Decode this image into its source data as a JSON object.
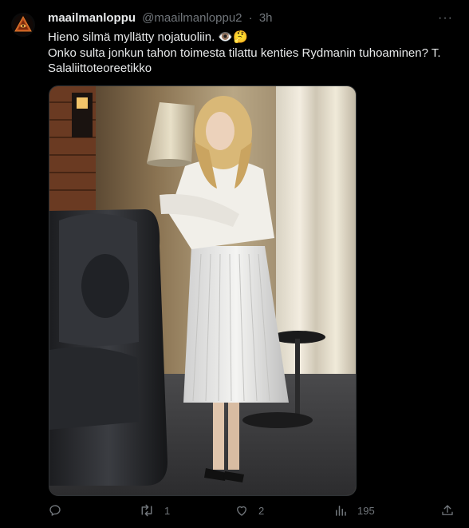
{
  "tweet": {
    "display_name": "maailmanloppu",
    "handle": "@maailmanloppu2",
    "separator": "·",
    "time": "3h",
    "more": "···",
    "text_line1": "Hieno silmä myllätty nojatuoliin. 👁️🤔",
    "text_line2": "Onko sulta jonkun tahon toimesta tilattu kenties Rydmanin tuhoaminen? T. Salaliittoteoreetikko"
  },
  "image": {
    "description_icon": "photo-woman-leaning-on-leather-armchair"
  },
  "actions": {
    "replies": "",
    "retweets": "1",
    "likes": "2",
    "views": "195"
  },
  "colors": {
    "background": "#000000",
    "text": "#e7e9ea",
    "muted": "#71767b",
    "border": "#2f3336"
  }
}
